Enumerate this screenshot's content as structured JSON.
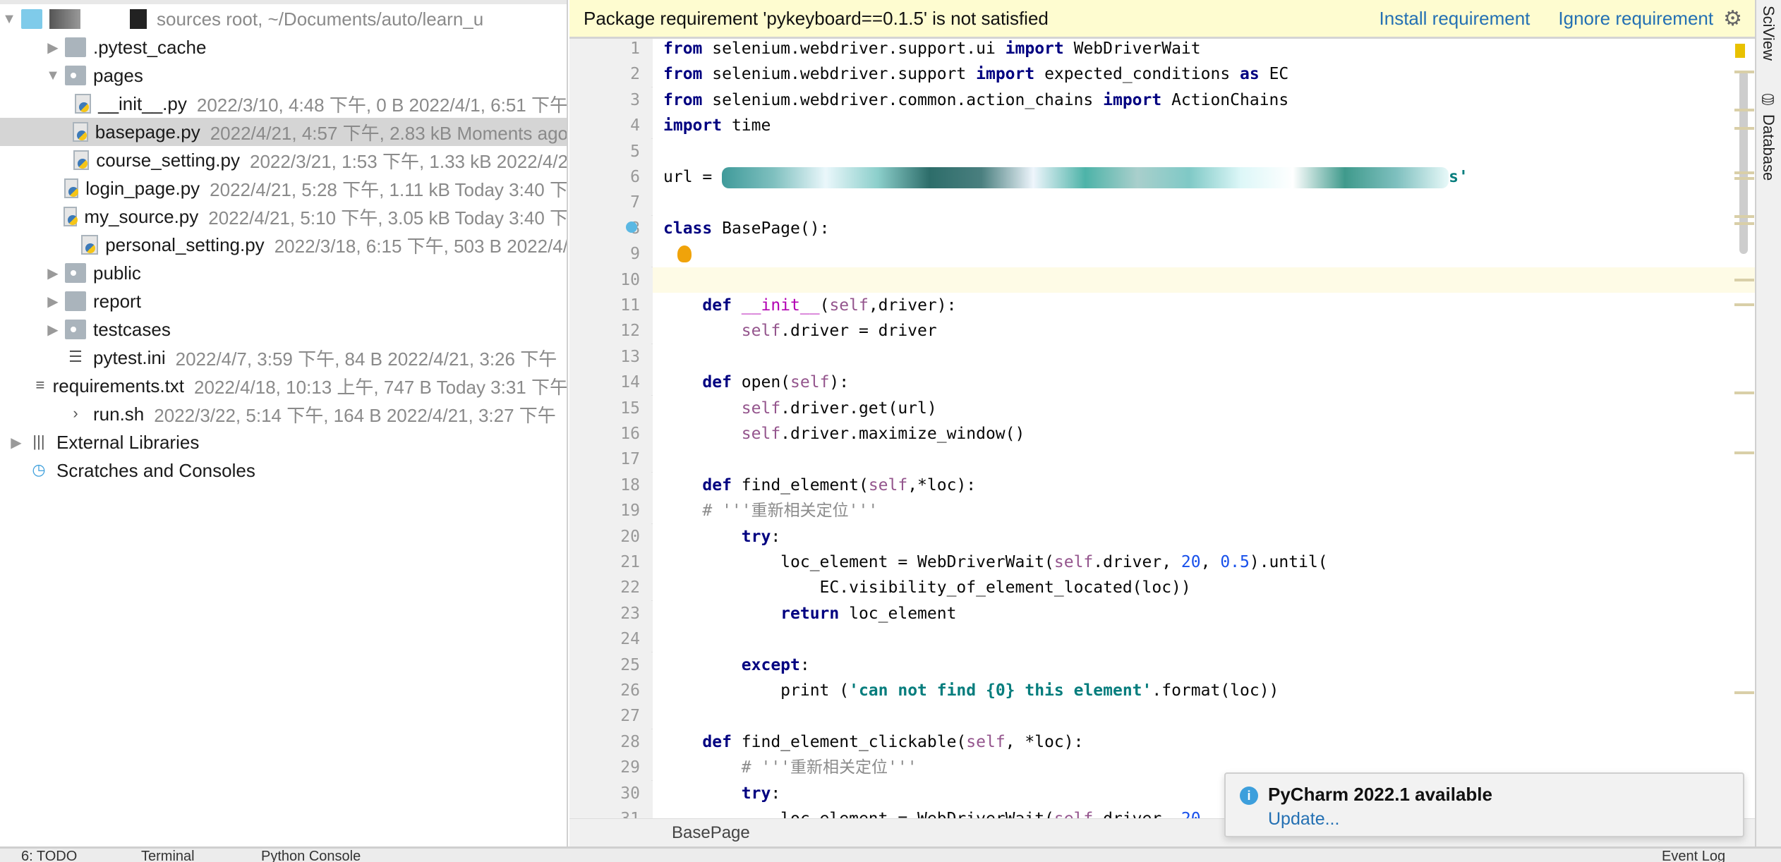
{
  "project_tree": {
    "root": {
      "label": "sources root,  ~/Documents/auto/learn_u"
    },
    "items": [
      {
        "level": 1,
        "arrow": "right",
        "icon": "folder",
        "label": ".pytest_cache",
        "meta": ""
      },
      {
        "level": 1,
        "arrow": "down",
        "icon": "package-folder",
        "label": "pages",
        "meta": ""
      },
      {
        "level": 2,
        "arrow": "",
        "icon": "python-file",
        "label": "__init__.py",
        "meta": "2022/3/10, 4:48 下午, 0 B 2022/4/1, 6:51 下午"
      },
      {
        "level": 2,
        "arrow": "",
        "icon": "python-file",
        "label": "basepage.py",
        "meta": "2022/4/21, 4:57 下午, 2.83 kB Moments ago",
        "selected": true
      },
      {
        "level": 2,
        "arrow": "",
        "icon": "python-file",
        "label": "course_setting.py",
        "meta": "2022/3/21, 1:53 下午, 1.33 kB 2022/4/2"
      },
      {
        "level": 2,
        "arrow": "",
        "icon": "python-file",
        "label": "login_page.py",
        "meta": "2022/4/21, 5:28 下午, 1.11 kB Today 3:40 下"
      },
      {
        "level": 2,
        "arrow": "",
        "icon": "python-file",
        "label": "my_source.py",
        "meta": "2022/4/21, 5:10 下午, 3.05 kB Today 3:40 下"
      },
      {
        "level": 2,
        "arrow": "",
        "icon": "python-file",
        "label": "personal_setting.py",
        "meta": "2022/3/18, 6:15 下午, 503 B 2022/4/"
      },
      {
        "level": 1,
        "arrow": "right",
        "icon": "package-folder",
        "label": "public",
        "meta": ""
      },
      {
        "level": 1,
        "arrow": "right",
        "icon": "folder",
        "label": "report",
        "meta": ""
      },
      {
        "level": 1,
        "arrow": "right",
        "icon": "package-folder",
        "label": "testcases",
        "meta": ""
      },
      {
        "level": 1,
        "arrow": "",
        "icon": "ini-file",
        "label": "pytest.ini",
        "meta": "2022/4/7, 3:59 下午, 84 B 2022/4/21, 3:26 下午"
      },
      {
        "level": 1,
        "arrow": "",
        "icon": "text-file",
        "label": "requirements.txt",
        "meta": "2022/4/18, 10:13 上午, 747 B Today 3:31 下午"
      },
      {
        "level": 1,
        "arrow": "",
        "icon": "shell-file",
        "label": "run.sh",
        "meta": "2022/3/22, 5:14 下午, 164 B 2022/4/21, 3:27 下午"
      },
      {
        "level": 0,
        "arrow": "right",
        "icon": "libraries",
        "label": "External Libraries",
        "meta": ""
      },
      {
        "level": 0,
        "arrow": "",
        "icon": "scratches",
        "label": "Scratches and Consoles",
        "meta": ""
      }
    ]
  },
  "banner": {
    "message": "Package requirement 'pykeyboard==0.1.5' is not satisfied",
    "install_label": "Install requirement",
    "ignore_label": "Ignore requirement",
    "settings_icon": "gear-icon"
  },
  "editor": {
    "current_line": 10,
    "lines": [
      [
        [
          "kw",
          "from"
        ],
        [
          "pl",
          " selenium.webdriver.support.ui "
        ],
        [
          "kw",
          "import"
        ],
        [
          "pl",
          " WebDriverWait"
        ]
      ],
      [
        [
          "kw",
          "from"
        ],
        [
          "pl",
          " selenium.webdriver.support "
        ],
        [
          "kw",
          "import"
        ],
        [
          "pl",
          " expected_conditions "
        ],
        [
          "kw",
          "as"
        ],
        [
          "pl",
          " EC"
        ]
      ],
      [
        [
          "kw",
          "from"
        ],
        [
          "pl",
          " selenium.webdriver.common.action_chains "
        ],
        [
          "kw",
          "import"
        ],
        [
          "pl",
          " ActionChains"
        ]
      ],
      [
        [
          "kw",
          "import"
        ],
        [
          "pl",
          " time"
        ]
      ],
      [],
      [
        [
          "pl",
          "url = "
        ],
        [
          "blur",
          ""
        ],
        [
          "str",
          "s'"
        ]
      ],
      [],
      [
        [
          "kw",
          "class"
        ],
        [
          "pl",
          " BasePage():"
        ]
      ],
      [
        [
          "bulb",
          ""
        ]
      ],
      [],
      [
        [
          "pl",
          "    "
        ],
        [
          "kw",
          "def"
        ],
        [
          "pl",
          " "
        ],
        [
          "fn",
          "__init__"
        ],
        [
          "pl",
          "("
        ],
        [
          "self",
          "self"
        ],
        [
          "pl",
          ",driver):"
        ]
      ],
      [
        [
          "pl",
          "        "
        ],
        [
          "self",
          "self"
        ],
        [
          "pl",
          ".driver = driver"
        ]
      ],
      [],
      [
        [
          "pl",
          "    "
        ],
        [
          "kw",
          "def"
        ],
        [
          "pl",
          " open("
        ],
        [
          "self",
          "self"
        ],
        [
          "pl",
          "):"
        ]
      ],
      [
        [
          "pl",
          "        "
        ],
        [
          "self",
          "self"
        ],
        [
          "pl",
          ".driver.get(url)"
        ]
      ],
      [
        [
          "pl",
          "        "
        ],
        [
          "self",
          "self"
        ],
        [
          "pl",
          ".driver.maximize_window()"
        ]
      ],
      [],
      [
        [
          "pl",
          "    "
        ],
        [
          "kw",
          "def"
        ],
        [
          "pl",
          " find_element("
        ],
        [
          "self",
          "self"
        ],
        [
          "pl",
          ",*loc):"
        ]
      ],
      [
        [
          "pl",
          "    "
        ],
        [
          "cmt",
          "# '''重新相关定位'''"
        ]
      ],
      [
        [
          "pl",
          "        "
        ],
        [
          "kw",
          "try"
        ],
        [
          "pl",
          ":"
        ]
      ],
      [
        [
          "pl",
          "            loc_element = WebDriverWait("
        ],
        [
          "self",
          "self"
        ],
        [
          "pl",
          ".driver, "
        ],
        [
          "num",
          "20"
        ],
        [
          "pl",
          ", "
        ],
        [
          "num",
          "0.5"
        ],
        [
          "pl",
          ").until("
        ]
      ],
      [
        [
          "pl",
          "                EC.visibility_of_element_located(loc))"
        ]
      ],
      [
        [
          "pl",
          "            "
        ],
        [
          "kw",
          "return"
        ],
        [
          "pl",
          " loc_element"
        ]
      ],
      [],
      [
        [
          "pl",
          "        "
        ],
        [
          "kw",
          "except"
        ],
        [
          "pl",
          ":"
        ]
      ],
      [
        [
          "pl",
          "            print ("
        ],
        [
          "str",
          "'can not find {0} this element'"
        ],
        [
          "pl",
          ".format(loc))"
        ]
      ],
      [],
      [
        [
          "pl",
          "    "
        ],
        [
          "kw",
          "def"
        ],
        [
          "pl",
          " find_element_clickable("
        ],
        [
          "self",
          "self"
        ],
        [
          "pl",
          ", *loc):"
        ]
      ],
      [
        [
          "pl",
          "        "
        ],
        [
          "cmt",
          "# '''重新相关定位'''"
        ]
      ],
      [
        [
          "pl",
          "        "
        ],
        [
          "kw",
          "try"
        ],
        [
          "pl",
          ":"
        ]
      ],
      [
        [
          "pl",
          "            loc_element = WebDriverWait("
        ],
        [
          "self",
          "self"
        ],
        [
          "pl",
          ".driver, "
        ],
        [
          "num",
          "20"
        ],
        [
          "pl",
          ","
        ]
      ]
    ]
  },
  "breadcrumb": {
    "label": "BasePage"
  },
  "right_tabs": {
    "sciview": "SciView",
    "database": "Database"
  },
  "bottom_tabs": {
    "todo": "6: TODO",
    "terminal": "Terminal",
    "console": "Python Console",
    "event_log": "Event Log"
  },
  "notification": {
    "title": "PyCharm 2022.1 available",
    "link": "Update..."
  }
}
